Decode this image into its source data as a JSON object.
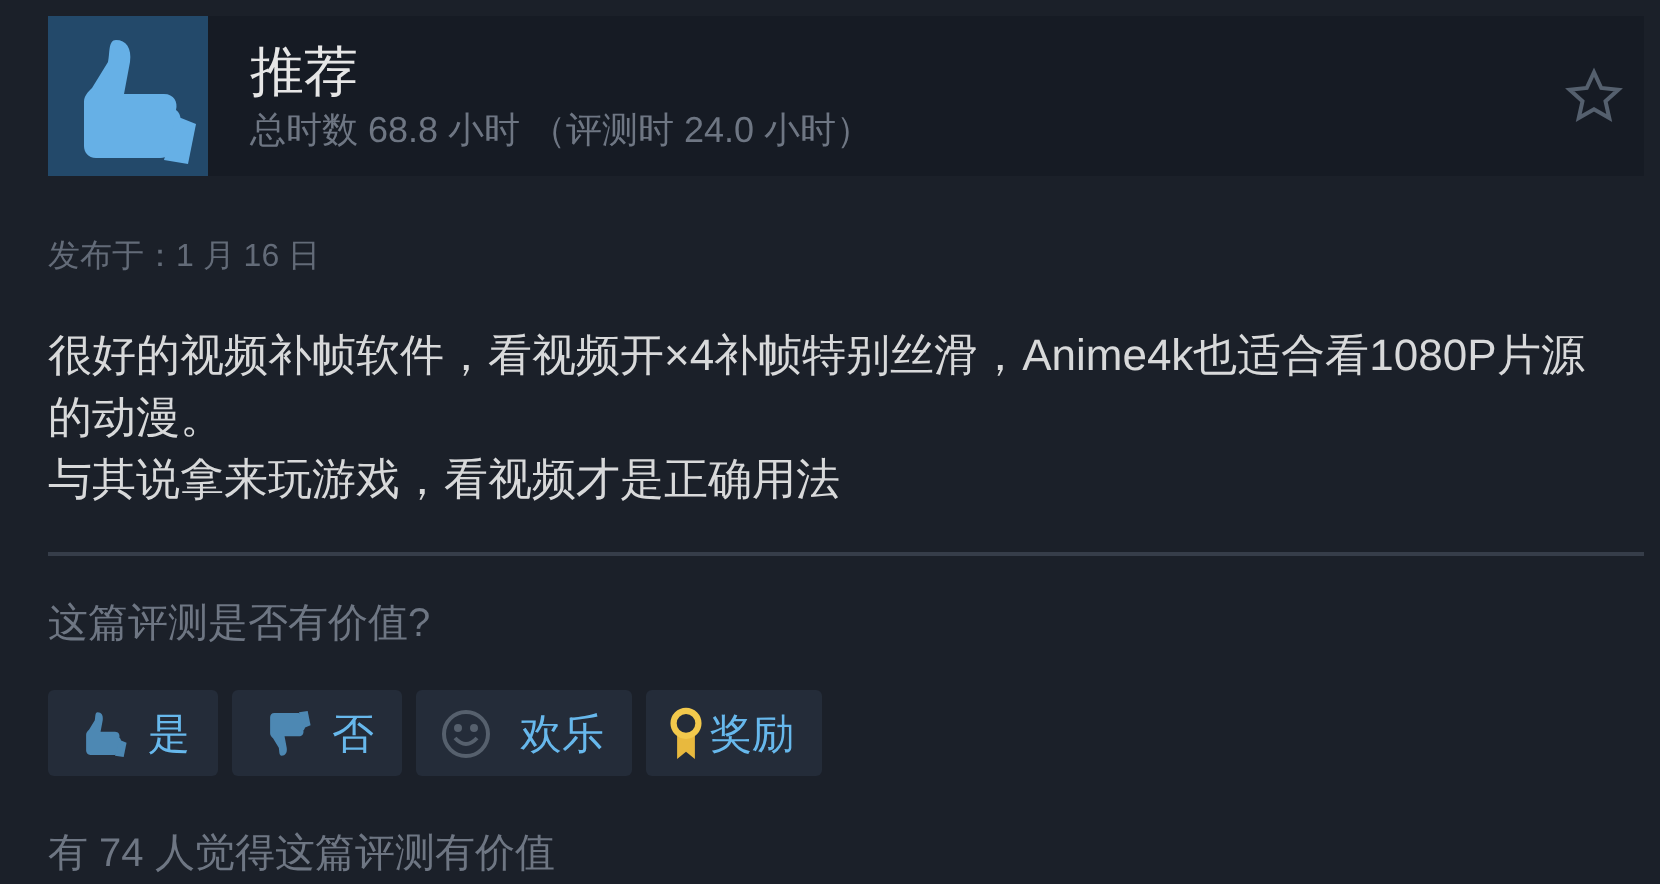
{
  "review": {
    "verdict": "推荐",
    "hours": "总时数 68.8 小时 （评测时 24.0 小时）"
  },
  "posted": "发布于：1 月 16 日",
  "paragraphs": [
    "很好的视频补帧软件，看视频开×4补帧特别丝滑，Anime4k也适合看1080P片源的动漫。",
    "与其说拿来玩游戏，看视频才是正确用法"
  ],
  "question": "这篇评测是否有价值?",
  "buttons": [
    {
      "kind": "thumbs-up",
      "label": "是"
    },
    {
      "kind": "thumbs-down",
      "label": "否"
    },
    {
      "kind": "smile",
      "label": "欢乐"
    },
    {
      "kind": "award",
      "label": "奖励"
    }
  ],
  "helpful": "有 74 人觉得这篇评测有价值"
}
